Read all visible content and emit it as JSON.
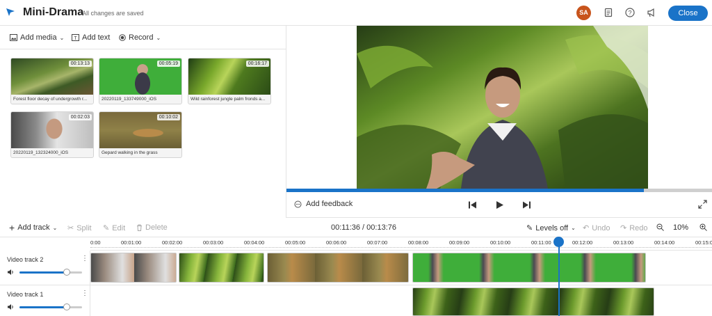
{
  "header": {
    "title": "Mini-Drama",
    "save_status": "All changes are saved",
    "avatar_initials": "SA",
    "close_label": "Close",
    "icons": [
      "logo-icon",
      "notes-icon",
      "help-icon",
      "announcement-icon"
    ]
  },
  "media_toolbar": {
    "add_media": "Add media",
    "add_text": "Add text",
    "record": "Record"
  },
  "media": [
    {
      "caption": "Forest floor decay of undergrowth r...",
      "duration": "00:13:13",
      "kind": "forest"
    },
    {
      "caption": "20220119_133749000_iOS",
      "duration": "00:05:19",
      "kind": "greenscreen"
    },
    {
      "caption": "Wild rainforest jungle palm fronds a...",
      "duration": "00:16:17",
      "kind": "palm"
    },
    {
      "caption": "20220119_132324000_iOS",
      "duration": "00:02:03",
      "kind": "indoor"
    },
    {
      "caption": "Gepard walking in the grass",
      "duration": "00:10:02",
      "kind": "cheetah"
    }
  ],
  "player": {
    "feedback_label": "Add feedback",
    "progress": 0.84
  },
  "timeline_toolbar": {
    "add_track": "Add track",
    "split": "Split",
    "edit": "Edit",
    "delete": "Delete",
    "timecode": "00:11:36 / 00:13:76",
    "levels": "Levels off",
    "undo": "Undo",
    "redo": "Redo",
    "zoom": "10%"
  },
  "ruler_ticks": [
    "0:00",
    "00:01:00",
    "00:02:00",
    "00:03:00",
    "00:04:00",
    "00:05:00",
    "00:06:00",
    "00:07:00",
    "00:08:00",
    "00:09:00",
    "00:10:00",
    "00:11:00",
    "00:12:00",
    "00:13:00",
    "00:14:00",
    "00:15:0"
  ],
  "tracks": [
    {
      "name": "Video track 2",
      "volume": 0.75
    },
    {
      "name": "Video track 1",
      "volume": 0.75
    }
  ],
  "colors": {
    "accent": "#1a73c8",
    "avatar": "#c8541c",
    "green_screen": "#3fae3a"
  }
}
